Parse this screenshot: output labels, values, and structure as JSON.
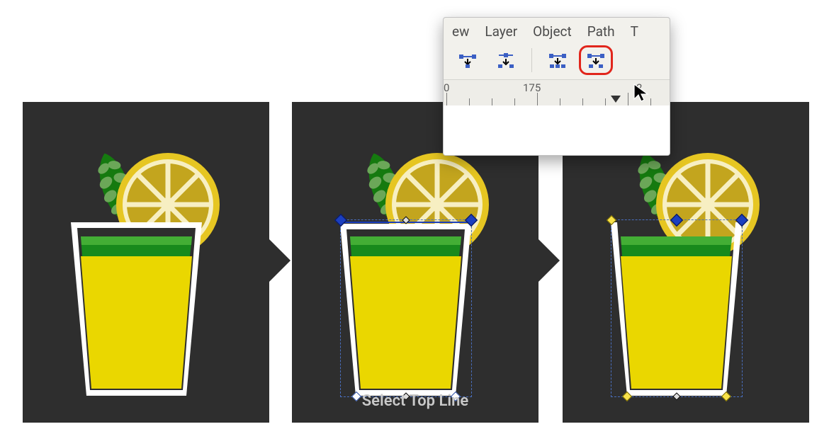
{
  "panel2_caption": "Select Top Line",
  "menu": {
    "view": "ew",
    "layer": "Layer",
    "object": "Object",
    "path": "Path",
    "t": "T"
  },
  "ruler": {
    "l0": "0",
    "l175": "175",
    "l20": "2"
  },
  "icons": {
    "insert_before": "insert-node-before-icon",
    "insert_after": "insert-node-after-icon",
    "delete_node": "delete-node-icon",
    "break_path": "break-path-icon"
  },
  "colors": {
    "panel": "#2e2e2e",
    "lemon_peel": "#e6c622",
    "lemon_flesh": "#c3a51e",
    "lemon_pith": "#f7efc2",
    "mint_dark": "#157a0f",
    "mint_light": "#6ba758",
    "juice": "#ead700",
    "juice_top": "#188a1c",
    "juice_top_light": "#43ae35"
  }
}
